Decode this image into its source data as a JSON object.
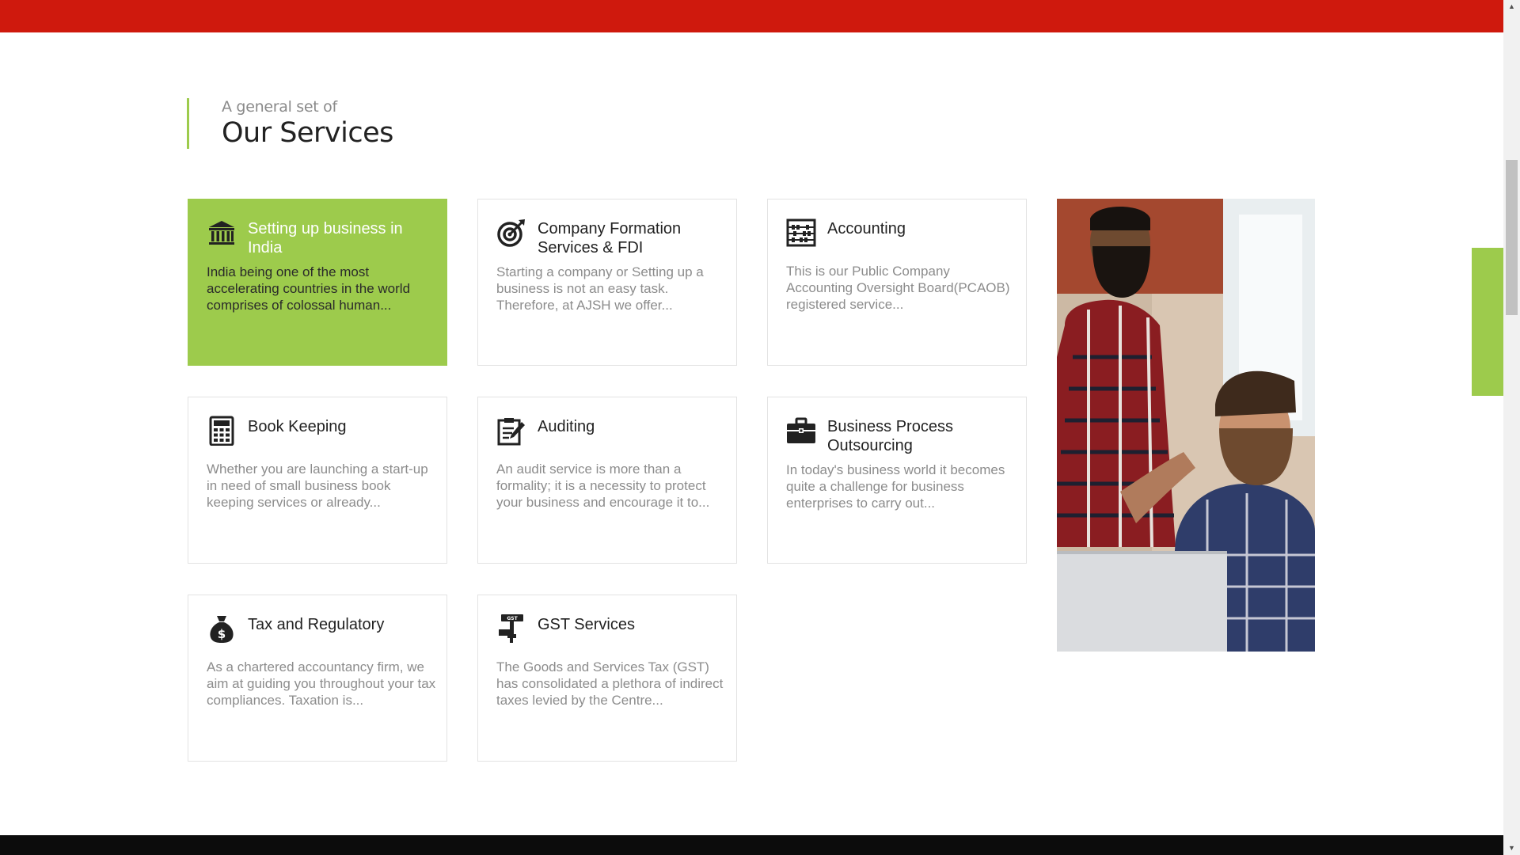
{
  "header": {
    "brand_color": "#cf190d"
  },
  "accent_color": "#9dcb4c",
  "section": {
    "subtitle": "A general set of",
    "title": "Our Services"
  },
  "services": [
    {
      "title": "Setting up business in India",
      "text": "India being one of the most accelerating countries in the world comprises of colossal human...",
      "icon": "bank-icon",
      "active": true
    },
    {
      "title": "Company Formation Services & FDI",
      "text": "Starting a company or Setting up a business is not an easy task. Therefore, at AJSH we offer...",
      "icon": "target-icon"
    },
    {
      "title": "Accounting",
      "text": "This is our Public Company Accounting Oversight Board(PCAOB) registered service...",
      "icon": "abacus-icon"
    },
    {
      "title": "Book Keeping",
      "text": "Whether you are launching a start-up in need of small business book keeping services or already...",
      "icon": "calculator-icon"
    },
    {
      "title": "Auditing",
      "text": "An audit service is more than a formality; it is a necessity to protect your business and encourage it to...",
      "icon": "clipboard-pen-icon"
    },
    {
      "title": "Business Process Outsourcing",
      "text": "In today's business world it becomes quite a challenge for business enterprises to carry out...",
      "icon": "briefcase-icon"
    },
    {
      "title": "Tax and Regulatory",
      "text": "As a chartered accountancy firm, we aim at guiding you throughout your tax compliances. Taxation is...",
      "icon": "money-bag-icon"
    },
    {
      "title": "GST Services",
      "text": "The Goods and Services Tax (GST) has consolidated a plethora of indirect taxes levied by the Centre...",
      "icon": "gst-stamp-icon"
    }
  ],
  "image": {
    "subject": "two-men-at-laptop-photo"
  }
}
